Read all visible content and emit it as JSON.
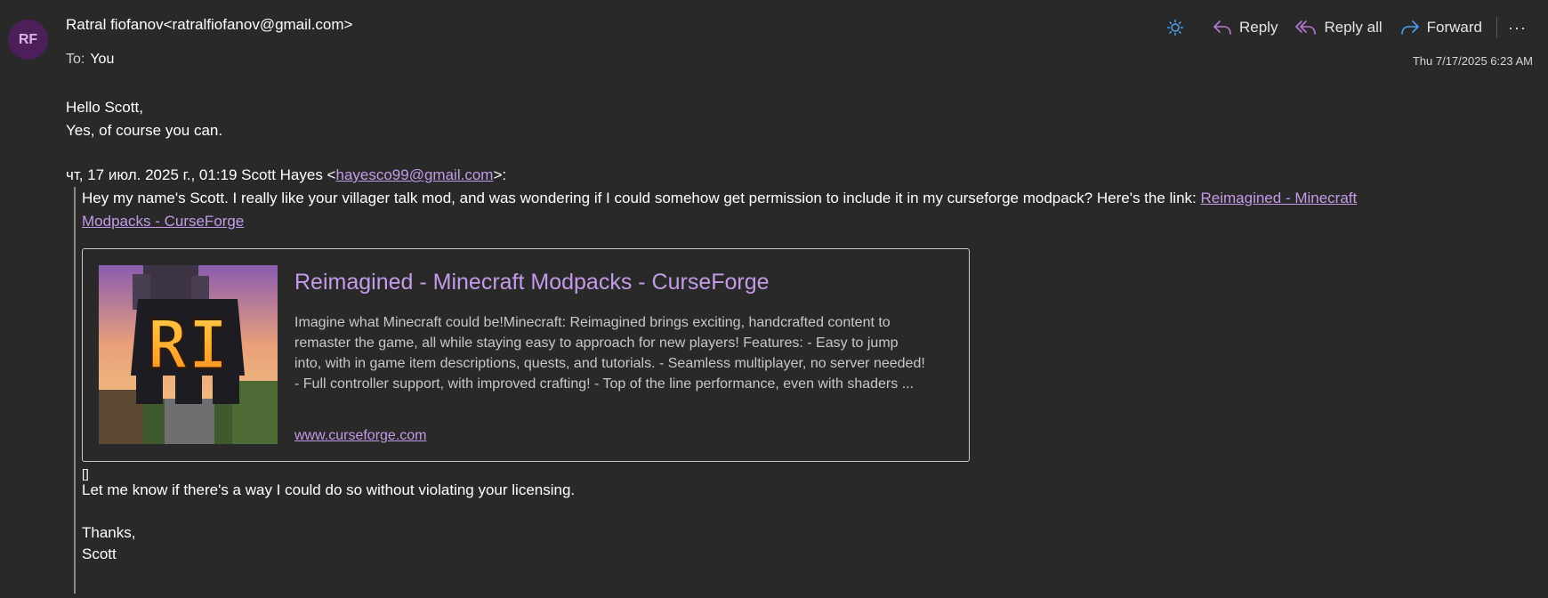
{
  "header": {
    "avatar_initials": "RF",
    "sender": "Ratral fiofanov<ratralfiofanov@gmail.com>",
    "to_label": "To:",
    "to_value": "You",
    "date": "Thu 7/17/2025 6:23 AM"
  },
  "actions": {
    "reply": "Reply",
    "reply_all": "Reply all",
    "forward": "Forward",
    "more": "···"
  },
  "body": {
    "greeting": "Hello Scott,",
    "line1": "Yes, of course you can."
  },
  "quote": {
    "header_prefix": "чт, 17 июл. 2025 г., 01:19 Scott Hayes <",
    "header_email": "hayesco99@gmail.com",
    "header_suffix": ">:",
    "intro_line1": "Hey my name's Scott. I really like your villager talk mod, and was wondering if I could somehow get permission to include it in my curseforge modpack? Here's the link: ",
    "link_part1": "Reimagined - Minecraft",
    "link_part2": "Modpacks - CurseForge",
    "placeholder_glyph": "[]",
    "ask": "Let me know if there's a way I could do so without violating your licensing.",
    "thanks": "Thanks,",
    "signature": "Scott"
  },
  "card": {
    "title": "Reimagined - Minecraft Modpacks - CurseForge",
    "description": "Imagine what Minecraft could be!Minecraft: Reimagined brings exciting, handcrafted content to remaster the game, all while staying easy to approach for new players! Features: - Easy to jump into, with in game item descriptions, quests, and tutorials. - Seamless multiplayer, no server needed! - Full controller support, with improved crafting! - Top of the line performance, even with shaders ...",
    "domain": "www.curseforge.com",
    "logo_text": "RI"
  },
  "colors": {
    "background": "#292929",
    "accent_purple": "#c49be8",
    "avatar_bg": "#4c1f5a",
    "forward_blue": "#4aa3f0"
  }
}
